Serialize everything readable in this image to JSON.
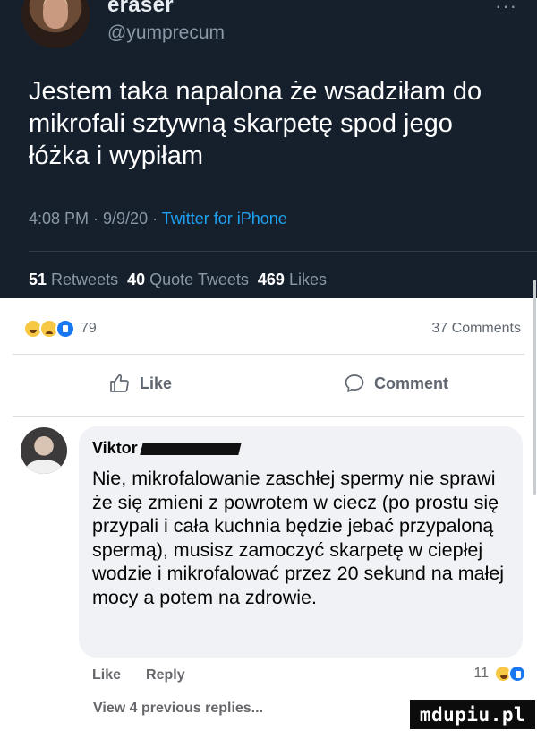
{
  "tweet": {
    "author_name": "eraser",
    "author_handle": "@yumprecum",
    "more_label": "···",
    "text": "Jestem taka napalona że wsadziłam do mikrofali sztywną skarpetę spod jego łóżka i wypiłam",
    "meta": "4:08 PM · 9/9/20 · ",
    "source": "Twitter for iPhone",
    "stats": {
      "retweets_value": "51",
      "retweets_label": "Retweets",
      "quotes_value": "40",
      "quotes_label": "Quote Tweets",
      "likes_value": "469",
      "likes_label": "Likes"
    }
  },
  "post": {
    "reactions": [
      "haha",
      "sad",
      "like"
    ],
    "reactions_count": "79",
    "comments_count": "37 Comments",
    "like_label": "Like",
    "comment_label": "Comment"
  },
  "comment": {
    "author": "Viktor",
    "text": "Nie, mikrofalowanie zaschłej spermy nie sprawi że się zmieni z powrotem w ciecz (po prostu się przypali i cała kuchnia będzie jebać przypaloną spermą), musisz zamoczyć skarpetę w ciepłej wodzie i mikrofalować przez 20 sekund na małej mocy a potem na zdrowie.",
    "like_label": "Like",
    "reply_label": "Reply",
    "reaction_count": "11",
    "reactions": [
      "haha",
      "like"
    ]
  },
  "view_previous": "View 4 previous replies...",
  "watermark": "mdupiu.pl",
  "colors": {
    "twitter_bg": "#16202d",
    "twitter_link": "#1da1f2",
    "fb_blue": "#1877f2",
    "bubble": "#f0f2f5"
  }
}
